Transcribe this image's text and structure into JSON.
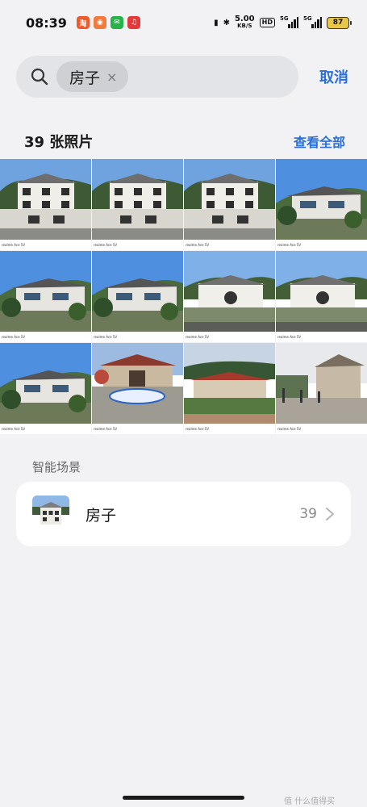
{
  "status_bar": {
    "time": "08:39",
    "net_speed": "5.00",
    "net_unit": "KB/S",
    "hd": "HD",
    "sim1": "5G",
    "sim2": "5G",
    "battery": "87"
  },
  "search": {
    "chip_text": "房子",
    "chip_close": "×",
    "cancel_label": "取消"
  },
  "photos": {
    "count_label": "39 张照片",
    "view_all_label": "查看全部",
    "watermark_text": "realme Ace 5V",
    "items": [
      {
        "scene": "villa"
      },
      {
        "scene": "villa"
      },
      {
        "scene": "villa"
      },
      {
        "scene": "hillside-house"
      },
      {
        "scene": "hillside-house"
      },
      {
        "scene": "hillside-house"
      },
      {
        "scene": "courtyard"
      },
      {
        "scene": "courtyard"
      },
      {
        "scene": "hillside-house"
      },
      {
        "scene": "temple-sign"
      },
      {
        "scene": "red-roof"
      },
      {
        "scene": "stone-plaza"
      }
    ]
  },
  "smart_scenes": {
    "title": "智能场景",
    "items": [
      {
        "name": "房子",
        "count": "39"
      }
    ]
  },
  "footer": {
    "site_watermark": "值 什么值得买"
  },
  "colors": {
    "accent": "#2b6fd6",
    "background": "#f2f2f4",
    "card": "#ffffff"
  }
}
